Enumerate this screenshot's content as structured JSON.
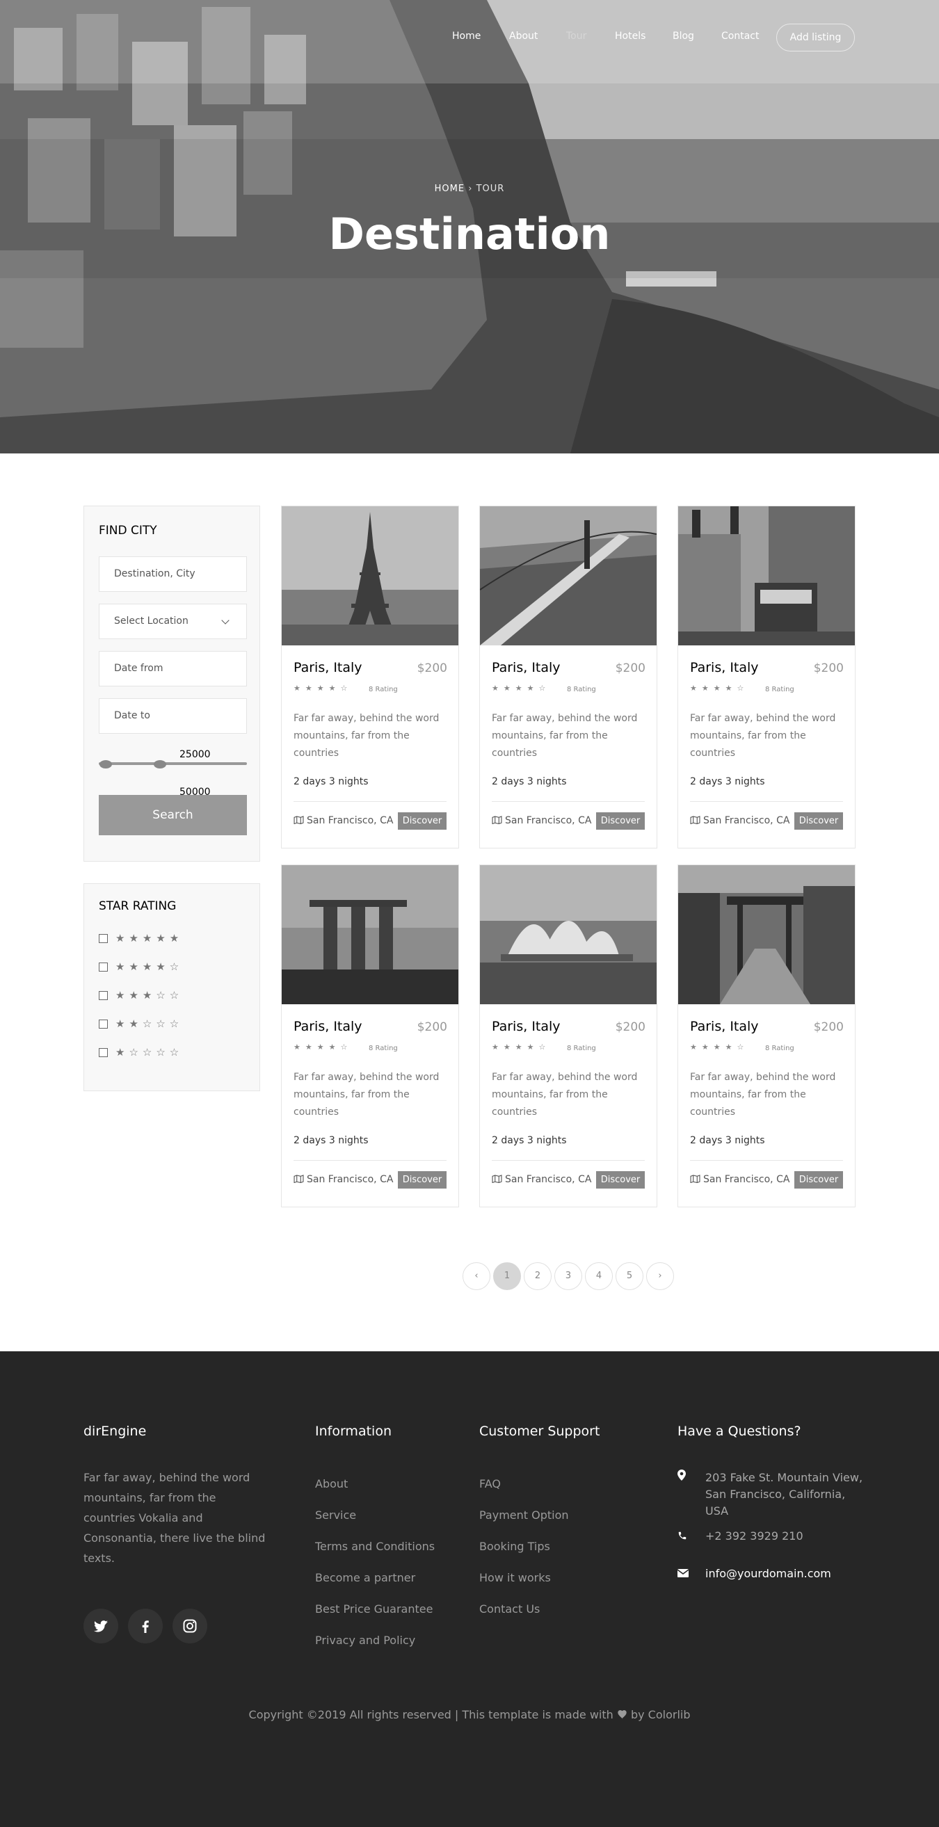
{
  "nav": {
    "items": [
      "Home",
      "About",
      "Tour",
      "Hotels",
      "Blog",
      "Contact"
    ],
    "active": "Tour",
    "cta": "Add listing"
  },
  "hero": {
    "breadcrumb_home": "HOME",
    "breadcrumb_sep": "›",
    "breadcrumb_current": "TOUR",
    "title": "Destination"
  },
  "find_city": {
    "title": "FIND CITY",
    "destination_placeholder": "Destination, City",
    "location_select": "Select Location",
    "date_from_placeholder": "Date from",
    "date_to_placeholder": "Date to",
    "range_min_label": "25000",
    "range_max_label": "50000",
    "search_label": "Search"
  },
  "star_rating": {
    "title": "STAR RATING",
    "rows": [
      5,
      4,
      3,
      2,
      1
    ]
  },
  "cards": [
    {
      "name": "Paris, Italy",
      "price": "$200",
      "rating": "8 Rating",
      "stars": 4,
      "desc": "Far far away, behind the word mountains, far from the countries",
      "days": "2 days 3 nights",
      "location": "San Francisco, CA",
      "button": "Discover",
      "image": "eiffel-tower"
    },
    {
      "name": "Paris, Italy",
      "price": "$200",
      "rating": "8 Rating",
      "stars": 4,
      "desc": "Far far away, behind the word mountains, far from the countries",
      "days": "2 days 3 nights",
      "location": "San Francisco, CA",
      "button": "Discover",
      "image": "golden-gate-bridge"
    },
    {
      "name": "Paris, Italy",
      "price": "$200",
      "rating": "8 Rating",
      "stars": 4,
      "desc": "Far far away, behind the word mountains, far from the countries",
      "days": "2 days 3 nights",
      "location": "San Francisco, CA",
      "button": "Discover",
      "image": "city-street-bus"
    },
    {
      "name": "Paris, Italy",
      "price": "$200",
      "rating": "8 Rating",
      "stars": 4,
      "desc": "Far far away, behind the word mountains, far from the countries",
      "days": "2 days 3 nights",
      "location": "San Francisco, CA",
      "button": "Discover",
      "image": "marina-bay-sands"
    },
    {
      "name": "Paris, Italy",
      "price": "$200",
      "rating": "8 Rating",
      "stars": 4,
      "desc": "Far far away, behind the word mountains, far from the countries",
      "days": "2 days 3 nights",
      "location": "San Francisco, CA",
      "button": "Discover",
      "image": "sydney-opera-house"
    },
    {
      "name": "Paris, Italy",
      "price": "$200",
      "rating": "8 Rating",
      "stars": 4,
      "desc": "Far far away, behind the word mountains, far from the countries",
      "days": "2 days 3 nights",
      "location": "San Francisco, CA",
      "button": "Discover",
      "image": "torii-gate-street"
    }
  ],
  "pagination": {
    "prev": "‹",
    "pages": [
      "1",
      "2",
      "3",
      "4",
      "5"
    ],
    "active": "1",
    "next": "›"
  },
  "footer": {
    "brand": "dirEngine",
    "about": "Far far away, behind the word mountains, far from the countries Vokalia and Consonantia, there live the blind texts.",
    "info_title": "Information",
    "info_links": [
      "About",
      "Service",
      "Terms and Conditions",
      "Become a partner",
      "Best Price Guarantee",
      "Privacy and Policy"
    ],
    "support_title": "Customer Support",
    "support_links": [
      "FAQ",
      "Payment Option",
      "Booking Tips",
      "How it works",
      "Contact Us"
    ],
    "contact_title": "Have a Questions?",
    "address": "203 Fake St. Mountain View, San Francisco, California, USA",
    "phone": "+2 392 3929 210",
    "email": "info@yourdomain.com",
    "social_icons": [
      "twitter-icon",
      "facebook-icon",
      "instagram-icon"
    ],
    "copyright_pre": "Copyright ©2019 All rights reserved | This template is made with",
    "copyright_post": "by Colorlib"
  }
}
